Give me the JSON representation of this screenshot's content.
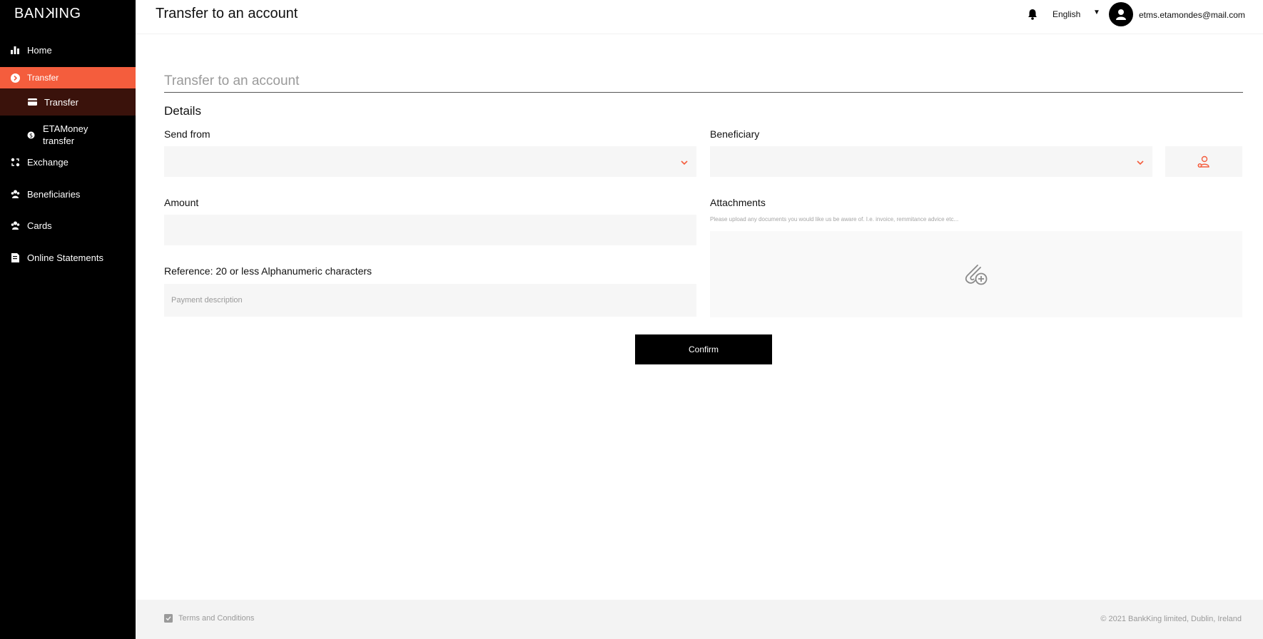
{
  "brand": {
    "logo_text_a": "BAN",
    "logo_text_k": "K",
    "logo_text_b": "ING"
  },
  "sidebar": {
    "items": [
      {
        "label": "Home",
        "icon": "bar-chart-icon"
      },
      {
        "label": "Transfer",
        "icon": "transfer-circle-icon",
        "active": true
      },
      {
        "label": "Transfer",
        "icon": "card-icon",
        "sub": true
      },
      {
        "label": "ETAMoney transfer",
        "icon": "money-icon",
        "sub": true
      },
      {
        "label": "Exchange",
        "icon": "exchange-icon"
      },
      {
        "label": "Beneficiaries",
        "icon": "people-icon"
      },
      {
        "label": "Cards",
        "icon": "people-icon"
      },
      {
        "label": "Online Statements",
        "icon": "document-icon"
      }
    ]
  },
  "header": {
    "title": "Transfer to an account",
    "language": "English",
    "user_email": "etms.etamondes@mail.com"
  },
  "form": {
    "page_title_value": "Transfer to an account",
    "details_title": "Details",
    "send_from_label": "Send from",
    "beneficiary_label": "Beneficiary",
    "amount_label": "Amount",
    "attachments_label": "Attachments",
    "attachments_hint": "Please upload any documents you would like us be aware of. I.e. invoice, remmitance advice etc...",
    "reference_label": "Reference: 20 or less Alphanumeric characters",
    "reference_placeholder": "Payment description",
    "confirm_label": "Confirm"
  },
  "footer": {
    "terms_label": "Terms and Conditions",
    "copyright": "© 2021 BankKing limited, Dublin, Ireland"
  },
  "colors": {
    "accent": "#f45d3d",
    "sidebar_bg": "#000000",
    "sub_active_bg": "#3a120b",
    "field_bg": "#f6f6f6"
  }
}
